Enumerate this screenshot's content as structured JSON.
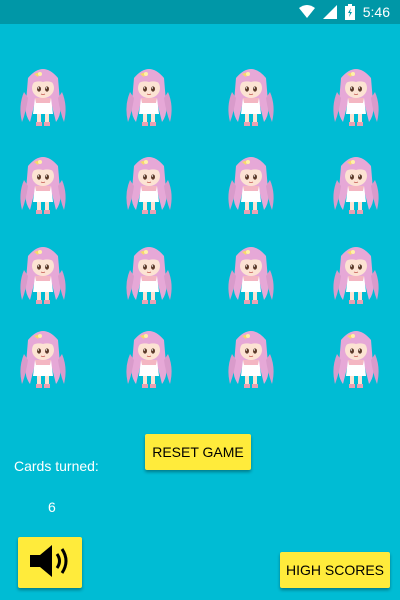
{
  "status_bar": {
    "time": "5:46",
    "icons": [
      "wifi-icon",
      "signal-icon",
      "battery-icon"
    ]
  },
  "game": {
    "card_back_icon": "chibi-girl-card-back-icon",
    "rows": 4,
    "cols": 4
  },
  "controls": {
    "reset_label": "RESET GAME",
    "cards_turned_label": "Cards turned:",
    "cards_turned_value": "6",
    "sound_icon": "speaker-icon",
    "high_scores_label": "HIGH SCORES"
  },
  "colors": {
    "background": "#00BCD4",
    "status_bar": "#0097A7",
    "button": "#FFEB3B",
    "text": "#FFFFFF"
  }
}
